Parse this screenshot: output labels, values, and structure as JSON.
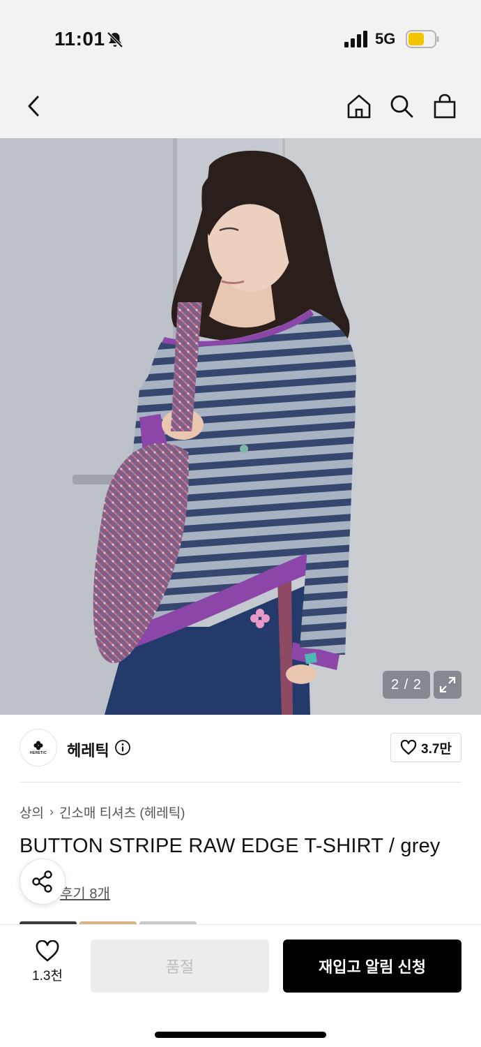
{
  "status": {
    "time": "11:01",
    "network": "5G",
    "icons": [
      "bell-slash-icon",
      "signal-icon",
      "battery-icon"
    ],
    "battery_color": "#f5c400"
  },
  "nav": {
    "icons": [
      "back-chevron-icon",
      "home-icon",
      "search-icon",
      "shopping-bag-icon"
    ]
  },
  "hero": {
    "counter": "2 / 2",
    "expand_icon": "expand-icon"
  },
  "brand": {
    "logo_text": "HERETIC",
    "name": "헤레틱",
    "info_icon": "info-icon",
    "likes": "3.7만"
  },
  "breadcrumb": {
    "category": "상의",
    "subcategory": "긴소매 티셔츠 (헤레틱)"
  },
  "product": {
    "title": "BUTTON STRIPE RAW EDGE T-SHIRT / grey",
    "review_prefix": "★",
    "review_text": "후기 8개"
  },
  "bottom": {
    "wish_count": "1.3천",
    "soldout_label": "품절",
    "restock_label": "재입고 알림 신청"
  },
  "colors": {
    "primary_button": "#000000",
    "disabled_button": "#ececec",
    "topbar_bg": "#f2f2f2"
  }
}
